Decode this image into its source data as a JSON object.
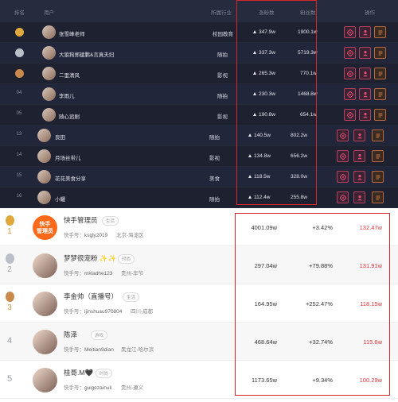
{
  "top_table": {
    "headers": {
      "rank": "排名",
      "user": "用户",
      "industry": "所属行业",
      "rise": "涨粉数",
      "fans": "粉丝数",
      "ops": "操作"
    },
    "rows": [
      {
        "rank": "",
        "medal": "gold",
        "name": "张雪峰老师",
        "industry": "校园教育",
        "rise": "347.9w",
        "fans": "1900.1w"
      },
      {
        "rank": "",
        "medal": "silver",
        "name": "大狼狗郑建鹏&言真夫妇",
        "industry": "随拍",
        "rise": "337.3w",
        "fans": "5719.3w"
      },
      {
        "rank": "",
        "medal": "bronze",
        "name": "二里清风",
        "industry": "影视",
        "rise": "265.3w",
        "fans": "770.1w"
      },
      {
        "rank": "04",
        "medal": "",
        "name": "李雨儿",
        "industry": "随拍",
        "rise": "230.3w",
        "fans": "1468.8w"
      },
      {
        "rank": "05",
        "medal": "",
        "name": "随心追剧",
        "industry": "影视",
        "rise": "190.8w",
        "fans": "654.1w"
      },
      {
        "rank": "13",
        "medal": "",
        "name": "良田",
        "industry": "随拍",
        "rise": "140.5w",
        "fans": "802.2w"
      },
      {
        "rank": "14",
        "medal": "",
        "name": "月场丝带儿",
        "industry": "影视",
        "rise": "134.8w",
        "fans": "656.2w"
      },
      {
        "rank": "15",
        "medal": "",
        "name": "花花美食分享",
        "industry": "美食",
        "rise": "118.5w",
        "fans": "328.0w"
      },
      {
        "rank": "16",
        "medal": "",
        "name": "小耀",
        "industry": "随拍",
        "rise": "112.4w",
        "fans": "255.8w"
      }
    ]
  },
  "bottom_list": {
    "id_prefix": "快手号：",
    "rows": [
      {
        "rank": "1",
        "medal": "gold",
        "name": "快手管理员",
        "tag": "生活",
        "id": "ksgly2019",
        "location": "北京-海淀区",
        "fans": "4001.09w",
        "growth": "+3.42%",
        "score": "132.47w",
        "logo_line1": "快手",
        "logo_line2": "管理员"
      },
      {
        "rank": "2",
        "medal": "silver",
        "name": "梦梦很宠粉 ✨✨",
        "tag": "时尚",
        "id": "mkladhe123",
        "location": "贵州-毕节",
        "fans": "297.04w",
        "growth": "+79.88%",
        "score": "131.91w"
      },
      {
        "rank": "3",
        "medal": "bronze",
        "name": "李金帅（直播号）",
        "tag": "生活",
        "id": "ljinshuau970804",
        "location": "四川-成都",
        "fans": "164.95w",
        "growth": "+252.47%",
        "score": "118.15w"
      },
      {
        "rank": "4",
        "medal": "",
        "name": "陈泽",
        "tag": "游戏",
        "id": "Meitian9dian",
        "location": "黑龙江-哈尔滨",
        "fans": "468.64w",
        "growth": "+32.74%",
        "score": "115.6w"
      },
      {
        "rank": "5",
        "medal": "",
        "name": "桂哥.M🖤",
        "tag": "时尚",
        "id": "guigezainuli",
        "location": "贵州-遵义",
        "fans": "1173.65w",
        "growth": "+9.34%",
        "score": "100.29w"
      }
    ]
  },
  "colors": {
    "highlight": "#d8262c",
    "score_red": "#e0353b",
    "dark_bg": "#1d2130",
    "gold": "#e0a93c",
    "silver": "#b9c0c9",
    "bronze": "#c98a4c"
  }
}
